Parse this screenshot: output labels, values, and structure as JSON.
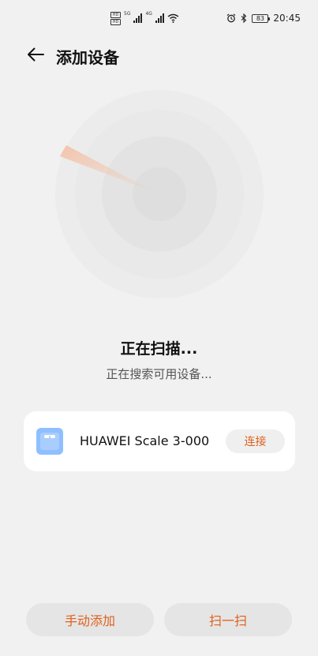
{
  "status_bar": {
    "sim1_label": "HD",
    "sim2_label": "HD",
    "net1": "5G",
    "net2": "4G",
    "battery": "83",
    "time": "20:45"
  },
  "header": {
    "title": "添加设备"
  },
  "scan": {
    "title": "正在扫描...",
    "subtitle": "正在搜索可用设备..."
  },
  "device": {
    "name": "HUAWEI Scale 3-000",
    "connect_label": "连接"
  },
  "actions": {
    "manual_add_label": "手动添加",
    "scan_label": "扫一扫"
  },
  "colors": {
    "accent": "#e0601c",
    "background": "#f1f1f1",
    "device_icon": "#8fbfff"
  }
}
